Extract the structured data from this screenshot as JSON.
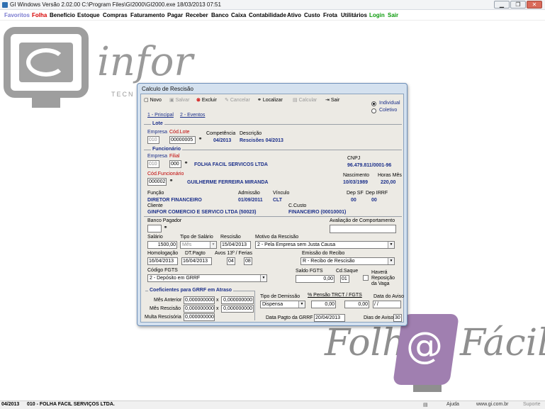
{
  "window": {
    "title": "GI Windows  Versão  2.02.00    C:\\Program Files\\GI2000\\GI2000.exe   18/03/2013 07:51"
  },
  "menu": [
    "Favoritos",
    "Folha",
    "Benefício",
    "Estoque",
    "Compras",
    "Faturamento",
    "Pagar",
    "Receber",
    "Banco",
    "Caixa",
    "Contabilidade",
    "Ativo",
    "Custo",
    "Frota",
    "Utilitários",
    "Login",
    "Sair"
  ],
  "brand": {
    "ginfor_big": "infor",
    "ginfor_sub": "TECN",
    "folha": "Folh",
    "folha_at": "@",
    "folha_facil": "Fácil"
  },
  "dialog": {
    "title": "Calculo de Rescisão",
    "toolbar": {
      "novo": "Novo",
      "salvar": "Salvar",
      "excluir": "Excluir",
      "cancelar": "Cancelar",
      "localizar": "Localizar",
      "calcular": "Calcular",
      "sair": "Sair"
    },
    "radios": {
      "individual": "Individual",
      "coletivo": "Coletivo"
    },
    "tabs": [
      "1 - Principal",
      "2 - Eventos"
    ],
    "lote": {
      "section": "Lote",
      "empresa_label": "Empresa",
      "empresa": "010",
      "cod_lote_label": "Cód.Lote",
      "cod_lote": "00000005",
      "competencia_label": "Competência",
      "competencia": "04/2013",
      "descricao_label": "Descrição",
      "descricao": "Rescisões 04/2013"
    },
    "funcionario": {
      "section": "Funcionário",
      "empresa_label": "Empresa",
      "empresa": "010",
      "filial_label": "Filial",
      "filial": "000",
      "filial_nome": "FOLHA FACIL SERVICOS LTDA",
      "cnpj_label": "CNPJ",
      "cnpj": "96.479.811/0001-96",
      "cod_label": "Cód.Funcionário",
      "cod": "000002",
      "nome": "GUILHERME FERREIRA MIRANDA",
      "nascimento_label": "Nascimento",
      "nascimento": "10/03/1989",
      "horas_label": "Horas Mês",
      "horas": "220,00",
      "funcao_label": "Função",
      "funcao": "DIRETOR FINANCEIRO",
      "admissao_label": "Admissão",
      "admissao": "01/09/2011",
      "vinculo_label": "Vínculo",
      "vinculo": "CLT",
      "depsf_label": "Dep SF",
      "depsf": "00",
      "depirrf_label": "Dep IRRF",
      "depirrf": "00",
      "cliente_label": "Cliente",
      "cliente": "GINFOR COMERCIO E SERVICO LTDA (50023)",
      "ccusto_label": "C.Custo",
      "ccusto": "FINANCEIRO (00010001)"
    },
    "rescisao": {
      "banco_label": "Banco Pagador",
      "avaliacao_label": "Avaliação de Comportamento",
      "salario_label": "Salário",
      "salario": "1500,00",
      "tipo_salario_label": "Tipo de Salário",
      "tipo_salario": "Mês",
      "rescisao_label": "Rescisão",
      "rescisao": "15/04/2013",
      "motivo_label": "Motivo da Rescisão",
      "motivo": "2 - Pela Empresa sem Justa Causa",
      "homologacao_label": "Homologação",
      "homologacao": "16/04/2013",
      "dtpagto_label": "DT.Pagto",
      "dtpagto": "16/04/2013",
      "avos_label": "Avos 13º / Ferias",
      "avos13": "04",
      "avosferias": "08",
      "emissao_label": "Emissão do Recibo",
      "emissao": "R - Recibo de Rescisão",
      "codfgts_label": "Código FGTS",
      "codfgts": "2 - Depósito em GRRF",
      "saldofgts_label": "Saldo FGTS",
      "saldofgts": "0,00",
      "cdsaque_label": "Cd.Saque",
      "cdsaque": "01",
      "havera_label": "Haverá Reposição da Vaga"
    },
    "grrf": {
      "section": "Coeficientes para GRRF em Atraso",
      "mes_anterior_label": "Mês Anterior",
      "mes_anterior": "0,000000000",
      "mes_anterior_b": "0,000000000",
      "mes_rescisao_label": "Mês Rescisão",
      "mes_rescisao": "0,000000000",
      "mes_rescisao_b": "0,000000000",
      "multa_label": "Multa Rescisória",
      "multa": "0,000000000",
      "x": "x"
    },
    "demissao": {
      "tipo_label": "Tipo de Demissão",
      "tipo": "Dispensa",
      "pensao_label": "% Pensão TRCT / FGTS",
      "pensao_trct": "0,00",
      "pensao_fgts": "0,00",
      "aviso_label": "Data do Aviso",
      "aviso": " / /",
      "pagto_grrf_label": "Data Pagto da GRRF",
      "pagto_grrf": "20/04/2013",
      "dias_aviso_label": "Dias de Aviso",
      "dias_aviso": "30"
    }
  },
  "status": {
    "comp": "04/2013",
    "empresa": "010 - FOLHA FACIL SERVIÇOS LTDA.",
    "ajuda": "Ajuda",
    "site": "www.gi.com.br",
    "suporte": "Suporte"
  },
  "colors": {
    "menu_favoritos": "#7b7bd0",
    "menu_folha": "#d80000",
    "menu_login": "#0a9a0a",
    "menu_sair": "#0a9a0a",
    "brand_gray": "#9a9a9a",
    "brand_purple": "#a07fb0",
    "accent_blue": "#1b2f8a"
  }
}
